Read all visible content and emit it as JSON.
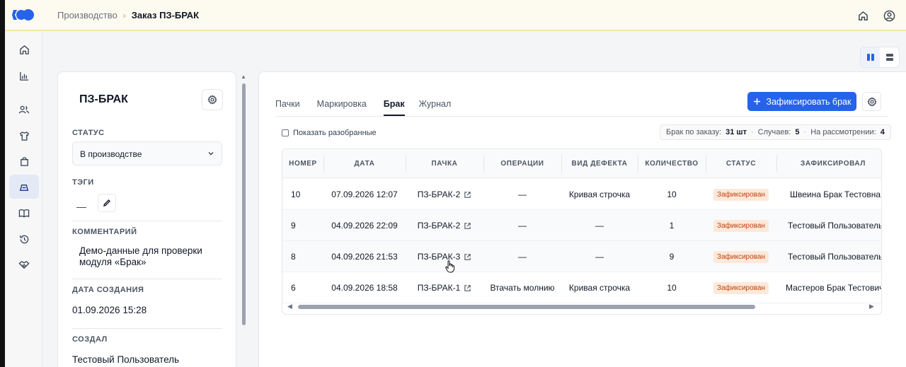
{
  "breadcrumb": {
    "parent": "Производство",
    "separator": "›",
    "current": "Заказ ПЗ-БРАК"
  },
  "order": {
    "title": "ПЗ-БРАК",
    "status_label": "СТАТУС",
    "status_value": "В производстве",
    "tags_label": "ТЭГИ",
    "tags_value": "—",
    "comment_label": "КОММЕНТАРИЙ",
    "comment_value": "Демо-данные для проверки модуля «Брак»",
    "created_date_label": "ДАТА СОЗДАНИЯ",
    "created_date_value": "01.09.2026 15:28",
    "created_by_label": "СОЗДАЛ",
    "created_by_value": "Тестовый Пользователь"
  },
  "tabs": [
    {
      "label": "Пачки",
      "active": false
    },
    {
      "label": "Маркировка",
      "active": false
    },
    {
      "label": "Брак",
      "active": true
    },
    {
      "label": "Журнал",
      "active": false
    }
  ],
  "actions": {
    "record_defect": "Зафиксировать брак"
  },
  "filters": {
    "show_resolved": "Показать разобранные",
    "show_resolved_checked": false
  },
  "stats": {
    "total_label": "Брак по заказу:",
    "total_value": "31 шт",
    "cases_label": "Случаев:",
    "cases_value": "5",
    "review_label": "На рассмотрении:",
    "review_value": "4"
  },
  "table": {
    "columns": [
      "НОМЕР",
      "ДАТА",
      "ПАЧКА",
      "ОПЕРАЦИИ",
      "ВИД ДЕФЕКТА",
      "КОЛИЧЕСТВО",
      "СТАТУС",
      "ЗАФИКСИРОВАЛ"
    ],
    "rows": [
      {
        "num": "10",
        "date": "07.09.2026 12:07",
        "batch": "ПЗ-БРАК-2",
        "ops": "—",
        "defect": "Кривая строчка",
        "qty": "10",
        "status": "Зафиксирован",
        "by": "Швеина Брак Тестовна"
      },
      {
        "num": "9",
        "date": "04.09.2026 22:09",
        "batch": "ПЗ-БРАК-2",
        "ops": "—",
        "defect": "—",
        "qty": "1",
        "status": "Зафиксирован",
        "by": "Тестовый Пользователь"
      },
      {
        "num": "8",
        "date": "04.09.2026 21:53",
        "batch": "ПЗ-БРАК-3",
        "ops": "—",
        "defect": "—",
        "qty": "9",
        "status": "Зафиксирован",
        "by": "Тестовый Пользователь"
      },
      {
        "num": "6",
        "date": "04.09.2026 18:58",
        "batch": "ПЗ-БРАК-1",
        "ops": "Втачать молнию",
        "defect": "Кривая строчка",
        "qty": "10",
        "status": "Зафиксирован",
        "by": "Мастеров Брак Тестович"
      }
    ]
  },
  "colors": {
    "accent": "#2563eb",
    "badge_bg": "#fde9d9",
    "badge_text": "#c2410c",
    "topbar": "#fdfbef"
  }
}
